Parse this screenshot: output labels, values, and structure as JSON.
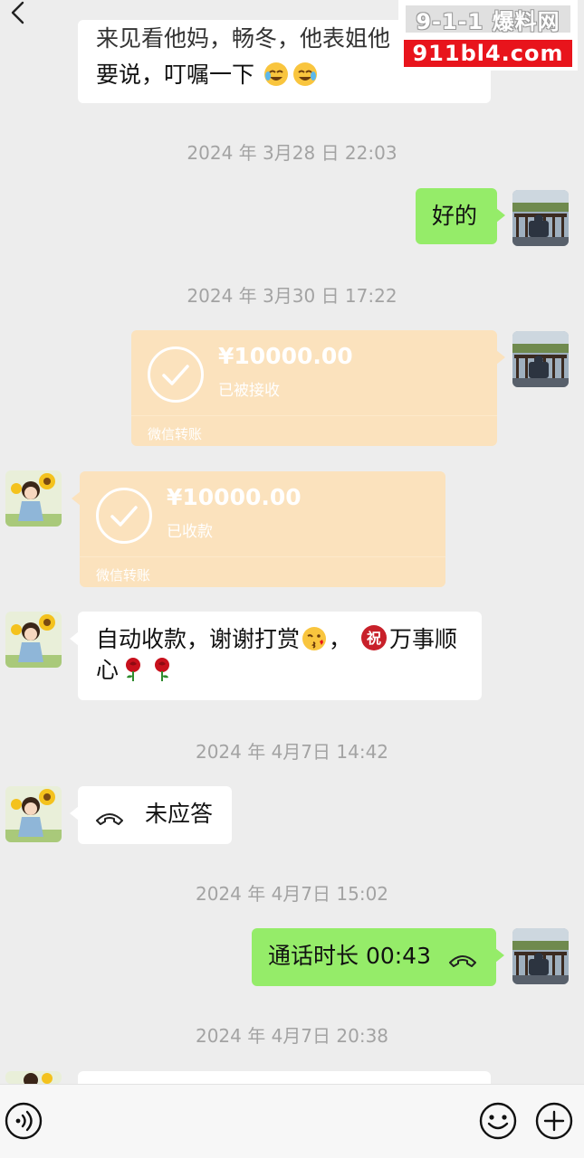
{
  "watermark": {
    "line1": "9-1-1 爆料网",
    "line2": "911bl4.com"
  },
  "messages": {
    "m1_line1": "来见看他妈，畅冬，他表姐他",
    "m1_line2": "要说，叮嘱一下",
    "ts1": "2024 年 3月28 日 22:03",
    "m2": "好的",
    "ts2": "2024 年 3月30 日 17:22",
    "transfer1": {
      "amount": "¥10000.00",
      "status": "已被接收",
      "footer": "微信转账"
    },
    "transfer2": {
      "amount": "¥10000.00",
      "status": "已收款",
      "footer": "微信转账"
    },
    "m3_line1_a": "自动收款，谢谢打赏",
    "m3_line1_b": "，",
    "m3_line1_c": "万事顺",
    "m3_line2": "心",
    "ts3": "2024 年 4月7日 14:42",
    "missed_call": "未应答",
    "ts4": "2024 年 4月7日 15:02",
    "call_duration": "通话时长 00:43",
    "ts5": "2024 年 4月7日 20:38"
  },
  "icons": {
    "back": "chevron-left-icon",
    "voice": "voice-icon",
    "emoji": "emoji-icon",
    "plus": "plus-icon",
    "blessing": "祝"
  },
  "colors": {
    "background": "#ededed",
    "green_bubble": "#95ec69",
    "transfer_card": "#fbe2bd",
    "watermark_red": "#e8141c"
  }
}
